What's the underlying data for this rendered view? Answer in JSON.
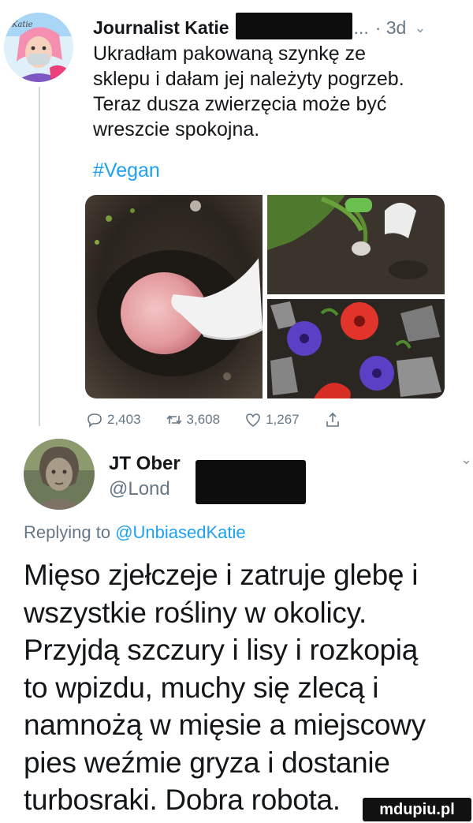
{
  "tweet": {
    "author_name": "Journalist Katie",
    "ellipsis": "...",
    "time": "· 3d",
    "chevron": "⌄",
    "lines": [
      "Ukradłam pakowaną szynkę ze",
      "sklepu i dałam jej należyty pogrzeb.",
      "Teraz dusza zwierzęcia może być",
      "wreszcie spokojna."
    ],
    "hashtag": "#Vegan",
    "actions": {
      "replies": "2,403",
      "retweets": "3,608",
      "likes": "1,267"
    },
    "icons": [
      "reply-icon",
      "retweet-icon",
      "like-icon",
      "share-icon"
    ]
  },
  "reply": {
    "name": "JT Ober",
    "handle": "@Lond",
    "chevron": "⌄",
    "replying_label": "Replying to",
    "replying_mention": "@UnbiasedKatie",
    "lines": [
      "Mięso zjełczeje i zatruje glebę i",
      "wszystkie rośliny w okolicy.",
      "Przyjdą szczury i lisy i rozkopią",
      "to wpizdu, muchy się zlecą i",
      "namnożą w mięsie a miejscowy",
      "pies weźmie gryza i dostanie",
      "turbosraki. Dobra robota."
    ]
  },
  "watermark": "mdupiu.pl",
  "colors": {
    "text": "#14171a",
    "muted": "#657786",
    "link": "#1da1f2",
    "redaction": "#0d0d0d"
  }
}
